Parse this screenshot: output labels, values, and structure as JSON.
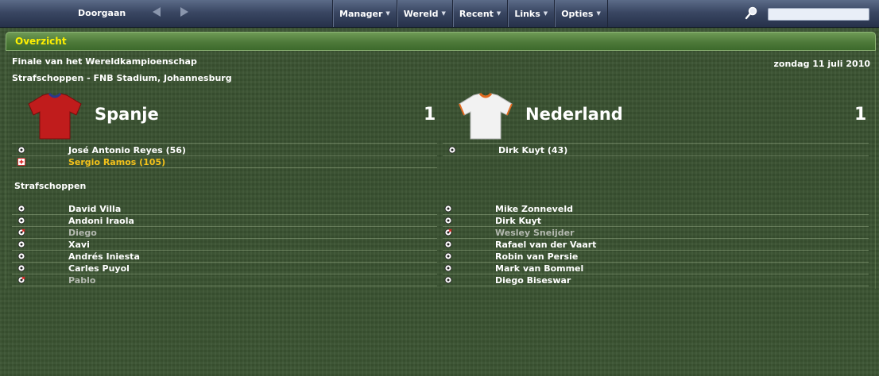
{
  "topbar": {
    "continue_label": "Doorgaan",
    "menu": [
      {
        "label": "Manager"
      },
      {
        "label": "Wereld"
      },
      {
        "label": "Recent"
      },
      {
        "label": "Links"
      },
      {
        "label": "Opties"
      }
    ],
    "search_value": ""
  },
  "section": {
    "title": "Overzicht"
  },
  "match": {
    "competition": "Finale van het Wereldkampioenschap",
    "venue": "Strafschoppen - FNB Stadium, Johannesburg",
    "date": "zondag 11 juli 2010"
  },
  "home": {
    "name": "Spanje",
    "score": "1",
    "shirt_color": "#c01c1c",
    "events": [
      {
        "text": "José Antonio Reyes (56)",
        "icon": "ball-icon",
        "style": "normal"
      },
      {
        "text": "Sergio Ramos (105)",
        "icon": "injury-icon",
        "style": "gold"
      }
    ],
    "penalties": [
      {
        "name": "David Villa",
        "scored": true
      },
      {
        "name": "Andoni Iraola",
        "scored": true
      },
      {
        "name": "Diego",
        "scored": false
      },
      {
        "name": "Xavi",
        "scored": true
      },
      {
        "name": "Andrés Iniesta",
        "scored": true
      },
      {
        "name": "Carles Puyol",
        "scored": true
      },
      {
        "name": "Pablo",
        "scored": false
      }
    ]
  },
  "away": {
    "name": "Nederland",
    "score": "1",
    "shirt_color": "#f2f2f2",
    "events": [
      {
        "text": "Dirk Kuyt (43)",
        "icon": "ball-icon",
        "style": "normal"
      }
    ],
    "penalties": [
      {
        "name": "Mike Zonneveld",
        "scored": true
      },
      {
        "name": "Dirk Kuyt",
        "scored": true
      },
      {
        "name": "Wesley Sneijder",
        "scored": false
      },
      {
        "name": "Rafael van der Vaart",
        "scored": true
      },
      {
        "name": "Robin van Persie",
        "scored": true
      },
      {
        "name": "Mark van Bommel",
        "scored": true
      },
      {
        "name": "Diego Biseswar",
        "scored": true
      }
    ]
  },
  "penalties_heading": "Strafschoppen",
  "colors": {
    "accent_title": "#fff000",
    "highlight": "#f4c21b",
    "missed": "#b4b9b0"
  }
}
